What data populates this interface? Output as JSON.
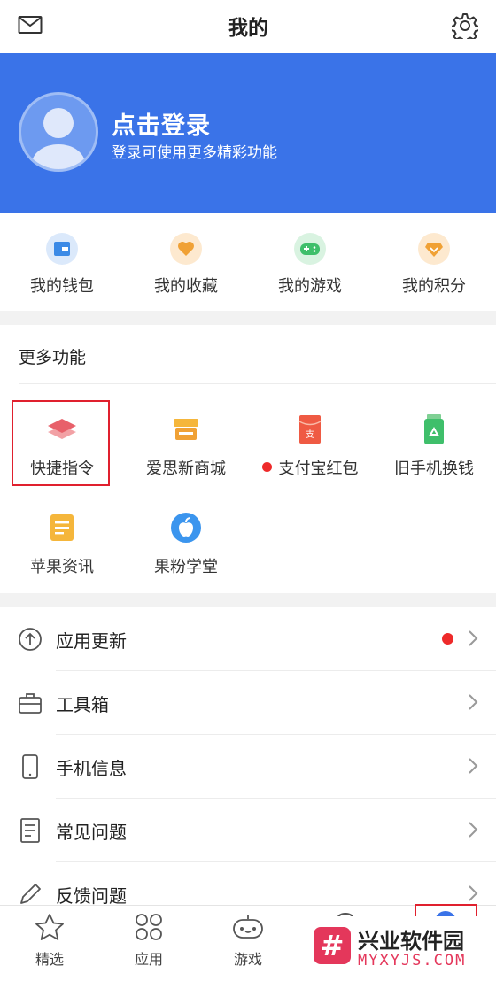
{
  "header": {
    "title": "我的",
    "mail_icon": "mail-icon",
    "settings_icon": "gear-icon"
  },
  "profile": {
    "login_title": "点击登录",
    "login_subtitle": "登录可使用更多精彩功能",
    "avatar_icon": "avatar-placeholder-icon",
    "banner_color": "#3a73e8"
  },
  "quick_actions": [
    {
      "label": "我的钱包",
      "icon": "wallet-icon",
      "color": "#3b8ae6"
    },
    {
      "label": "我的收藏",
      "icon": "heart-icon",
      "color": "#f0a135"
    },
    {
      "label": "我的游戏",
      "icon": "gamepad-icon",
      "color": "#3fbf6b"
    },
    {
      "label": "我的积分",
      "icon": "diamond-icon",
      "color": "#f0a135"
    }
  ],
  "more_features": {
    "title": "更多功能",
    "items": [
      {
        "label": "快捷指令",
        "icon": "shortcuts-layers-icon",
        "highlighted": true
      },
      {
        "label": "爱思新商城",
        "icon": "store-icon"
      },
      {
        "label": "支付宝红包",
        "icon": "alipay-red-envelope-icon",
        "badge": "red-dot"
      },
      {
        "label": "旧手机换钱",
        "icon": "phone-recycle-icon"
      },
      {
        "label": "苹果资讯",
        "icon": "news-icon"
      },
      {
        "label": "果粉学堂",
        "icon": "apple-icon"
      }
    ]
  },
  "menu_list": [
    {
      "label": "应用更新",
      "icon": "upload-arrow-icon",
      "badge": "red-dot"
    },
    {
      "label": "工具箱",
      "icon": "toolbox-icon"
    },
    {
      "label": "手机信息",
      "icon": "phone-icon"
    },
    {
      "label": "常见问题",
      "icon": "document-icon"
    },
    {
      "label": "反馈问题",
      "icon": "pencil-icon"
    }
  ],
  "tab_bar": [
    {
      "label": "精选",
      "icon": "star-icon"
    },
    {
      "label": "应用",
      "icon": "apps-grid-icon"
    },
    {
      "label": "游戏",
      "icon": "gamepad-icon"
    }
  ],
  "watermark": {
    "title": "兴业软件园",
    "url": "MYXYJS.COM",
    "mark": "#"
  },
  "colors": {
    "accent": "#3a73e8",
    "highlight_border": "#e0202e",
    "badge": "#ee2a2a"
  }
}
